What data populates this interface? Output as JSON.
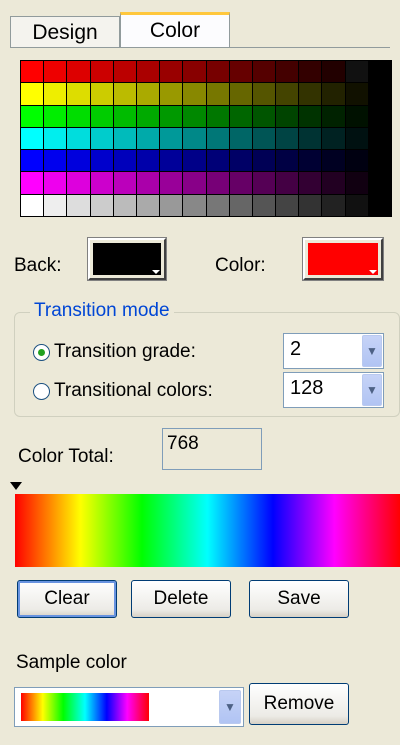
{
  "tabs": [
    {
      "label": "Design",
      "active": false
    },
    {
      "label": "Color",
      "active": true
    }
  ],
  "palette": {
    "rows": [
      [
        "#ff0000",
        "#ee0000",
        "#dd0000",
        "#cc0000",
        "#bb0000",
        "#aa0000",
        "#990000",
        "#880000",
        "#770000",
        "#660000",
        "#550000",
        "#440000",
        "#330000",
        "#220000",
        "#111111",
        "#000000"
      ],
      [
        "#ffff00",
        "#eeee00",
        "#dddd00",
        "#cccc00",
        "#bbbb00",
        "#aaaa00",
        "#999900",
        "#888800",
        "#777700",
        "#666600",
        "#555500",
        "#444400",
        "#333300",
        "#222200",
        "#111100",
        "#000000"
      ],
      [
        "#00ff00",
        "#00ee00",
        "#00dd00",
        "#00cc00",
        "#00bb00",
        "#00aa00",
        "#009900",
        "#008800",
        "#007700",
        "#006600",
        "#005500",
        "#004400",
        "#003300",
        "#002200",
        "#001100",
        "#000000"
      ],
      [
        "#00ffff",
        "#00eeee",
        "#00dddd",
        "#00cccc",
        "#00bbbb",
        "#00aaaa",
        "#009999",
        "#008888",
        "#007777",
        "#006666",
        "#005555",
        "#004444",
        "#003333",
        "#002222",
        "#001111",
        "#000000"
      ],
      [
        "#0000ff",
        "#0000ee",
        "#0000dd",
        "#0000cc",
        "#0000bb",
        "#0000aa",
        "#000099",
        "#000088",
        "#000077",
        "#000066",
        "#000055",
        "#000044",
        "#000033",
        "#000022",
        "#000011",
        "#000000"
      ],
      [
        "#ff00ff",
        "#ee00ee",
        "#dd00dd",
        "#cc00cc",
        "#bb00bb",
        "#aa00aa",
        "#990099",
        "#880088",
        "#770077",
        "#660066",
        "#550055",
        "#440044",
        "#330033",
        "#220022",
        "#110011",
        "#000000"
      ],
      [
        "#ffffff",
        "#eeeeee",
        "#dddddd",
        "#cccccc",
        "#bbbbbb",
        "#aaaaaa",
        "#999999",
        "#888888",
        "#777777",
        "#666666",
        "#555555",
        "#444444",
        "#333333",
        "#222222",
        "#111111",
        "#000000"
      ]
    ]
  },
  "back": {
    "label": "Back:",
    "color": "#000000"
  },
  "color": {
    "label": "Color:",
    "color": "#ff0000"
  },
  "transition": {
    "title": "Transition mode",
    "grade_label": "Transition grade:",
    "grade_value": "2",
    "colors_label": "Transitional colors:",
    "colors_value": "128",
    "selected": "grade"
  },
  "color_total": {
    "label": "Color Total:",
    "value": "768"
  },
  "buttons": {
    "clear": "Clear",
    "delete": "Delete",
    "save": "Save"
  },
  "sample": {
    "label": "Sample color",
    "remove": "Remove"
  },
  "icons": {
    "dropdown": "chevron-down-icon",
    "marker": "triangle-down-icon"
  }
}
